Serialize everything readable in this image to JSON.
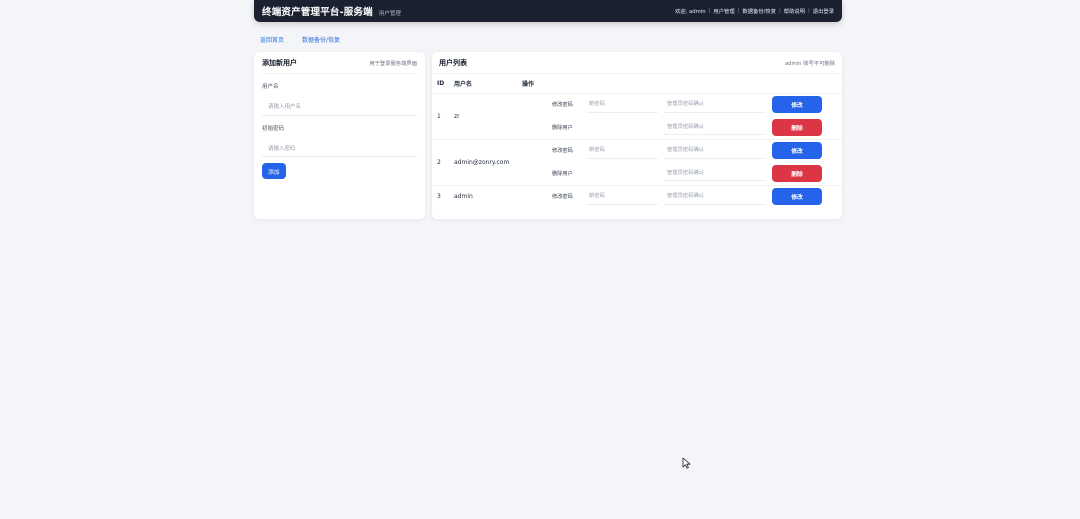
{
  "header": {
    "title": "终端资产管理平台-服务端",
    "subtitle": "用户管理",
    "nav": [
      "欢迎, admin",
      "用户管理",
      "数据备份/恢复",
      "帮助说明",
      "退出登录"
    ]
  },
  "quicklinks": [
    "返回首页",
    "数据备份/恢复"
  ],
  "add_user": {
    "title": "添加新用户",
    "hint": "用于登录服务端界面",
    "username_label": "用户名",
    "username_placeholder": "请输入用户名",
    "password_label": "初始密码",
    "password_placeholder": "请输入密码",
    "submit": "添加"
  },
  "user_list": {
    "title": "用户列表",
    "hint": "admin 账号不可删除",
    "columns": [
      "ID",
      "用户名",
      "操作"
    ],
    "op_change_label": "修改密码",
    "op_delete_label": "删除用户",
    "new_password_placeholder": "新密码",
    "admin_password_placeholder": "管理员密码确认",
    "edit_button": "修改",
    "delete_button": "删除",
    "rows": [
      {
        "id": "1",
        "username": "zr"
      },
      {
        "id": "2",
        "username": "admin@zonry.com"
      },
      {
        "id": "3",
        "username": "admin"
      }
    ]
  },
  "colors": {
    "topbar": "#1b2131",
    "primary": "#2563eb",
    "danger": "#dc3545",
    "link": "#2f6fe0",
    "background": "#f4f5f8"
  }
}
